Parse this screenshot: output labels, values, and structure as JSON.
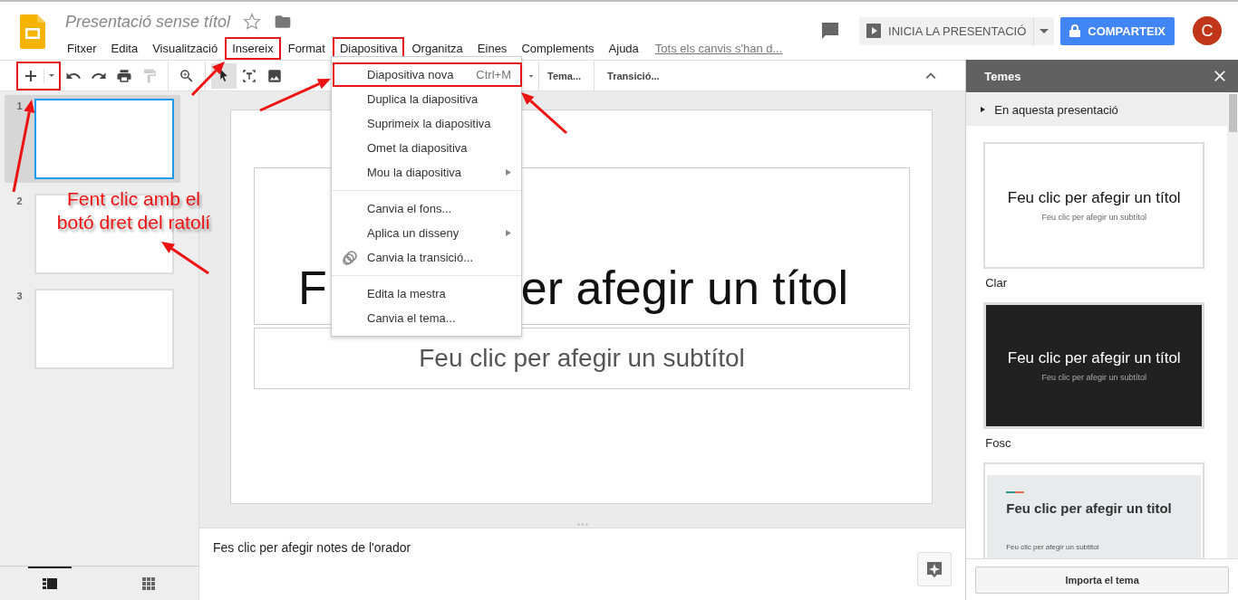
{
  "header": {
    "title": "Presentació sense títol",
    "menus": [
      {
        "label": "Fitxer",
        "highlighted": false
      },
      {
        "label": "Edita",
        "highlighted": false
      },
      {
        "label": "Visualització",
        "highlighted": false
      },
      {
        "label": "Insereix",
        "highlighted": true
      },
      {
        "label": "Format",
        "highlighted": false
      },
      {
        "label": "Diapositiva",
        "highlighted": true
      },
      {
        "label": "Organitza",
        "highlighted": false
      },
      {
        "label": "Eines",
        "highlighted": false
      },
      {
        "label": "Complements",
        "highlighted": false
      },
      {
        "label": "Ajuda",
        "highlighted": false
      }
    ],
    "save_status": "Tots els canvis s'han d...",
    "present_button": "INICIA LA PRESENTACIÓ",
    "share_button": "COMPARTEIX",
    "avatar": "C"
  },
  "toolbar": {
    "new_slide_highlighted": true,
    "buttons": [
      "Tema...",
      "Transició..."
    ]
  },
  "menu": {
    "items": [
      {
        "kind": "item",
        "label": "Diapositiva nova",
        "shortcut": "Ctrl+M",
        "submenu": false,
        "icon": false,
        "highlighted": true
      },
      {
        "kind": "item",
        "label": "Duplica la diapositiva",
        "submenu": false,
        "icon": false,
        "highlighted": false
      },
      {
        "kind": "item",
        "label": "Suprimeix la diapositiva",
        "submenu": false,
        "icon": false,
        "highlighted": false
      },
      {
        "kind": "item",
        "label": "Omet la diapositiva",
        "submenu": false,
        "icon": false,
        "highlighted": false
      },
      {
        "kind": "item",
        "label": "Mou la diapositiva",
        "submenu": true,
        "icon": false,
        "highlighted": false
      },
      {
        "kind": "separator"
      },
      {
        "kind": "item",
        "label": "Canvia el fons...",
        "submenu": false,
        "icon": false,
        "highlighted": false
      },
      {
        "kind": "item",
        "label": "Aplica un disseny",
        "submenu": true,
        "icon": false,
        "highlighted": false
      },
      {
        "kind": "item",
        "label": "Canvia la transició...",
        "submenu": false,
        "icon": true,
        "highlighted": false
      },
      {
        "kind": "separator"
      },
      {
        "kind": "item",
        "label": "Edita la mestra",
        "submenu": false,
        "icon": false,
        "highlighted": false
      },
      {
        "kind": "item",
        "label": "Canvia el tema...",
        "submenu": false,
        "icon": false,
        "highlighted": false
      }
    ]
  },
  "filmstrip": {
    "slides": [
      {
        "number": "1",
        "selected": true
      },
      {
        "number": "2",
        "selected": false
      },
      {
        "number": "3",
        "selected": false
      }
    ],
    "view_tabs": [
      {
        "kind": "list",
        "selected": true
      },
      {
        "kind": "grid",
        "selected": false
      }
    ]
  },
  "slide": {
    "title_parts": [
      "F",
      "er afegir un títol"
    ],
    "subtitle": "Feu clic per afegir un subtítol"
  },
  "notes": {
    "placeholder": "Fes clic per afegir notes de l'orador"
  },
  "themes": {
    "title": "Temes",
    "section": "En aquesta presentació",
    "items": [
      {
        "kind": "light",
        "name": "Clar",
        "title": "Feu clic per afegir un títol",
        "subtitle": "Feu clic per afegir un subtítol"
      },
      {
        "kind": "dark",
        "name": "Fosc",
        "title": "Feu clic per afegir un títol",
        "subtitle": "Feu clic per afegir un subtítol"
      },
      {
        "kind": "accent",
        "title": "Feu clic per afegir un titol",
        "subtitle": "Feu clic per afegir un subtitol"
      }
    ],
    "import_button": "Importa el tema"
  },
  "annotation": {
    "lines": [
      "Fent clic amb el",
      "botó dret del ratolí"
    ]
  }
}
